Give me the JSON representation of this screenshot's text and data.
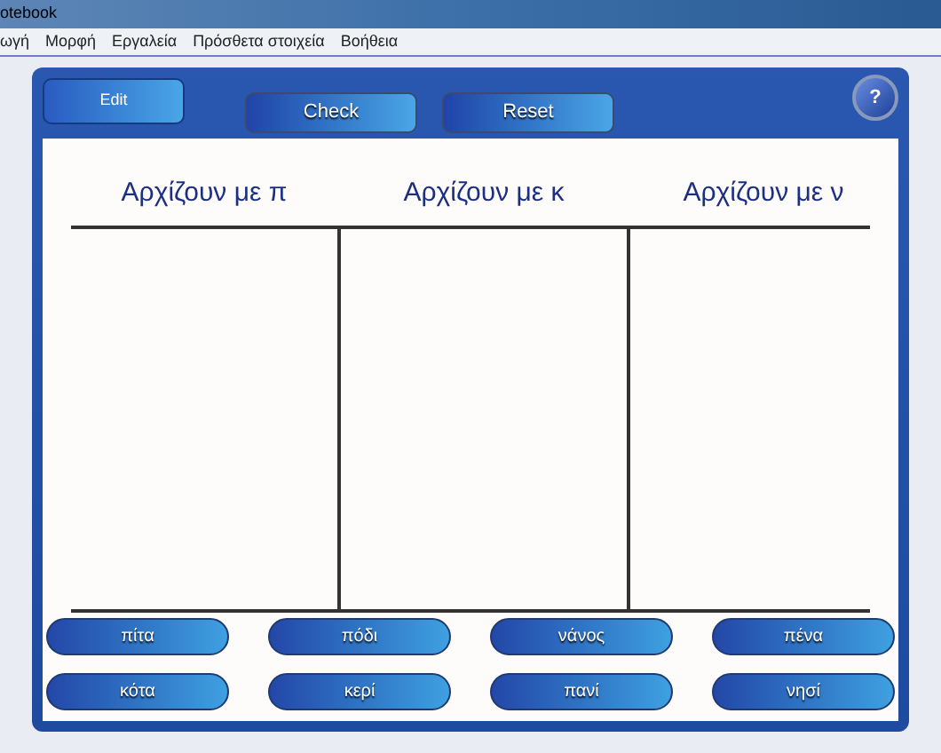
{
  "window": {
    "title": "otebook"
  },
  "menu": [
    "ωγή",
    "Μορφή",
    "Εργαλεία",
    "Πρόσθετα στοιχεία",
    "Βοήθεια"
  ],
  "edit_tab": "Edit",
  "buttons": [
    "Check",
    "Reset"
  ],
  "help": "?",
  "columns": [
    "Αρχίζουν με π",
    "Αρχίζουν με κ",
    "Αρχίζουν με ν"
  ],
  "words": [
    [
      "πίτα",
      "πόδι",
      "νάνος",
      "πένα"
    ],
    [
      "κότα",
      "κερί",
      "πανί",
      "νησί"
    ]
  ]
}
